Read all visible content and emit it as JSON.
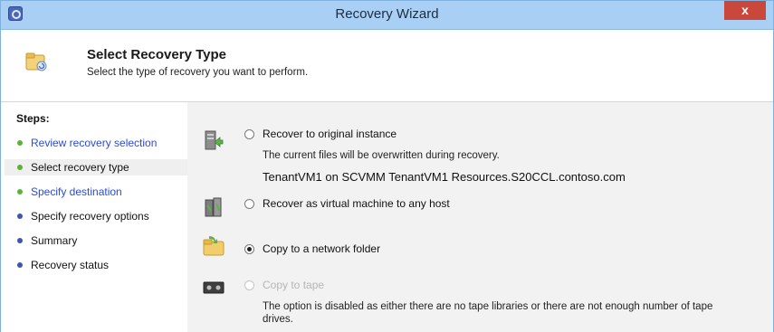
{
  "window": {
    "title": "Recovery Wizard",
    "close_label": "x"
  },
  "header": {
    "title": "Select Recovery Type",
    "subtitle": "Select the type of recovery you want to perform."
  },
  "steps": {
    "title": "Steps:",
    "items": [
      {
        "label": "Review recovery selection",
        "state": "done"
      },
      {
        "label": "Select recovery type",
        "state": "current"
      },
      {
        "label": "Specify destination",
        "state": "done"
      },
      {
        "label": "Specify recovery options",
        "state": "pending"
      },
      {
        "label": "Summary",
        "state": "pending"
      },
      {
        "label": "Recovery status",
        "state": "pending"
      }
    ]
  },
  "options": {
    "original": {
      "label": "Recover to original instance",
      "note": "The current files will be overwritten during recovery.",
      "instance": "TenantVM1 on  SCVMM TenantVM1 Resources.S20CCL.contoso.com",
      "selected": false
    },
    "any_host": {
      "label": "Recover as virtual machine to any host",
      "selected": false
    },
    "network_folder": {
      "label": "Copy to a network folder",
      "selected": true
    },
    "tape": {
      "label": "Copy to tape",
      "note_line1": "The option is disabled as either there are no tape libraries or there are not enough number of tape",
      "note_line2": "drives.",
      "disabled": true
    }
  },
  "colors": {
    "titlebar": "#a9d0f4",
    "link": "#2a4bdb",
    "done_dot": "#5ab434",
    "pending_dot": "#3e56b3",
    "close": "#c9483b"
  }
}
